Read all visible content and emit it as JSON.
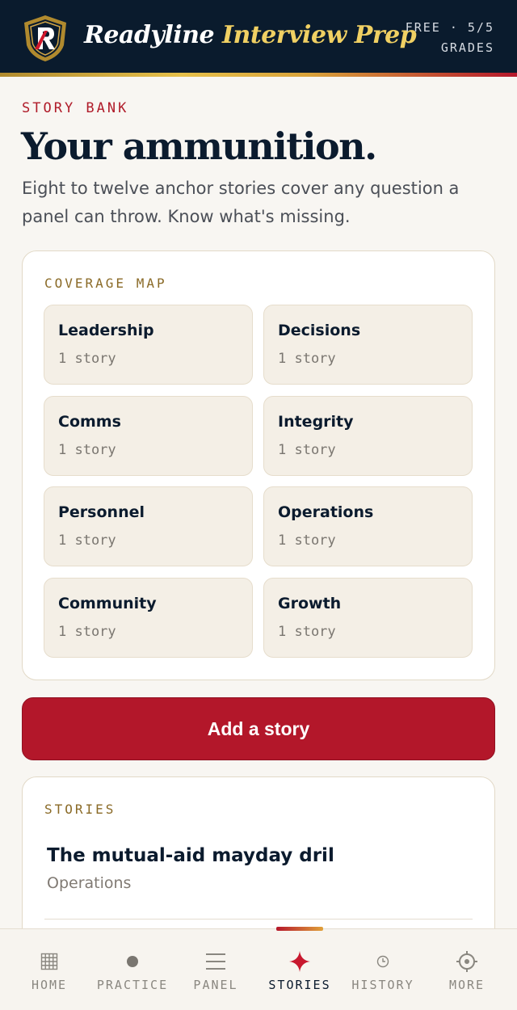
{
  "header": {
    "brand_primary": "Readyline",
    "brand_secondary": "Interview Prep",
    "plan_line1": "FREE · 5/5",
    "plan_line2": "GRADES"
  },
  "intro": {
    "eyebrow": "STORY BANK",
    "title": "Your ammunition.",
    "lede": "Eight to twelve anchor stories cover any question a panel can throw. Know what's missing."
  },
  "coverage": {
    "label": "COVERAGE MAP",
    "tiles": [
      {
        "name": "Leadership",
        "count": "1 story"
      },
      {
        "name": "Decisions",
        "count": "1 story"
      },
      {
        "name": "Comms",
        "count": "1 story"
      },
      {
        "name": "Integrity",
        "count": "1 story"
      },
      {
        "name": "Personnel",
        "count": "1 story"
      },
      {
        "name": "Operations",
        "count": "1 story"
      },
      {
        "name": "Community",
        "count": "1 story"
      },
      {
        "name": "Growth",
        "count": "1 story"
      }
    ]
  },
  "actions": {
    "add_story": "Add a story"
  },
  "stories": {
    "label": "STORIES",
    "items": [
      {
        "title": "The mutual-aid mayday dril",
        "category": "Operations"
      }
    ]
  },
  "nav": {
    "active": "STORIES",
    "items": [
      {
        "label": "HOME",
        "icon": "grid-icon"
      },
      {
        "label": "PRACTICE",
        "icon": "dot-icon"
      },
      {
        "label": "PANEL",
        "icon": "lines-icon"
      },
      {
        "label": "STORIES",
        "icon": "sparkle-icon"
      },
      {
        "label": "HISTORY",
        "icon": "clock-icon"
      },
      {
        "label": "MORE",
        "icon": "gear-icon"
      }
    ]
  },
  "colors": {
    "navy": "#0a1b2d",
    "accent_red": "#b3172a",
    "gold": "#f0d063",
    "background": "#f8f6f2"
  }
}
